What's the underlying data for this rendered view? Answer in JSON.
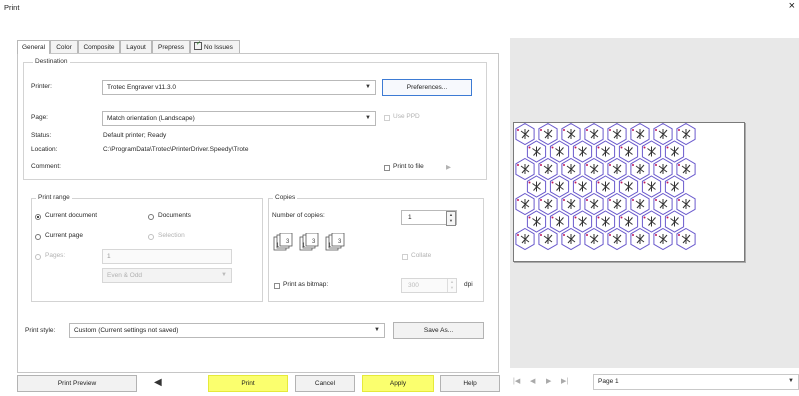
{
  "window": {
    "title": "Print"
  },
  "tabs": [
    {
      "label": "General"
    },
    {
      "label": "Color"
    },
    {
      "label": "Composite"
    },
    {
      "label": "Layout"
    },
    {
      "label": "Prepress"
    },
    {
      "label": "No Issues"
    }
  ],
  "destination": {
    "legend": "Destination",
    "printer_label": "Printer:",
    "printer_value": "Trotec Engraver v11.3.0",
    "preferences_button": "Preferences...",
    "page_label": "Page:",
    "page_value": "Match orientation (Landscape)",
    "use_ppd_label": "Use PPD",
    "status_label": "Status:",
    "status_value": "Default printer; Ready",
    "location_label": "Location:",
    "location_value": "C:\\ProgramData\\Trotec\\PrinterDriver.Speedy\\Trote",
    "comment_label": "Comment:",
    "print_to_file_label": "Print to file"
  },
  "print_range": {
    "legend": "Print range",
    "current_document": "Current document",
    "documents": "Documents",
    "current_page": "Current page",
    "selection": "Selection",
    "pages_label": "Pages:",
    "pages_value": "1",
    "even_odd_value": "Even & Odd"
  },
  "copies": {
    "legend": "Copies",
    "number_label": "Number of copies:",
    "number_value": "1",
    "collate_label": "Collate",
    "print_as_bitmap_label": "Print as bitmap:",
    "dpi_value": "300",
    "dpi_unit": "dpi"
  },
  "print_style": {
    "label": "Print style:",
    "value": "Custom (Current settings not saved)",
    "save_as_button": "Save As..."
  },
  "buttons": {
    "print_preview": "Print Preview",
    "print": "Print",
    "cancel": "Cancel",
    "apply": "Apply",
    "help": "Help"
  },
  "preview": {
    "page_label": "Page 1",
    "rows": [
      8,
      7,
      8,
      7,
      8,
      7,
      8
    ]
  },
  "colors": {
    "highlight": "#fbff6e",
    "hexagon_stroke": "#6a5acd"
  },
  "icons": {
    "close": "×",
    "preview_toggle": "◀",
    "nav_first": "|◀",
    "nav_prev": "◀",
    "nav_next": "▶",
    "nav_last": "▶|",
    "dropdown": "▼"
  }
}
